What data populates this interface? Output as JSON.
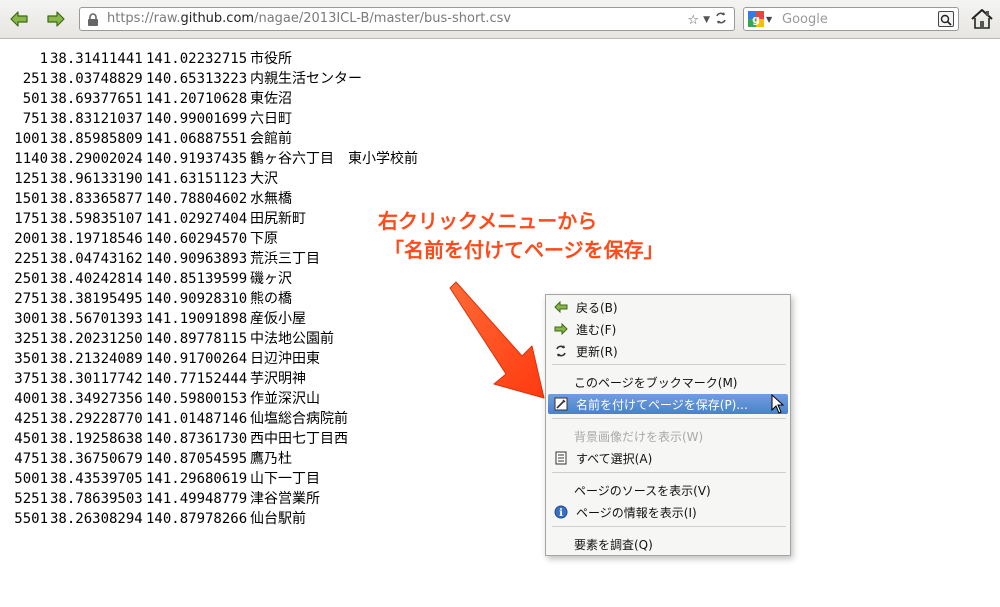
{
  "browser": {
    "url_prefix": "https://raw.",
    "url_host": "github.com",
    "url_path": "/nagae/2013ICL-B/master/bus-short.csv",
    "search_placeholder": "Google"
  },
  "rows": [
    {
      "id": "1",
      "lat": "38.31411441",
      "lon": "141.02232715",
      "name": "市役所"
    },
    {
      "id": "251",
      "lat": "38.03748829",
      "lon": "140.65313223",
      "name": "内親生活センター"
    },
    {
      "id": "501",
      "lat": "38.69377651",
      "lon": "141.20710628",
      "name": "東佐沼"
    },
    {
      "id": "751",
      "lat": "38.83121037",
      "lon": "140.99001699",
      "name": "六日町"
    },
    {
      "id": "1001",
      "lat": "38.85985809",
      "lon": "141.06887551",
      "name": "会館前"
    },
    {
      "id": "1140",
      "lat": "38.29002024",
      "lon": "140.91937435",
      "name": "鶴ヶ谷六丁目　東小学校前"
    },
    {
      "id": "1251",
      "lat": "38.96133190",
      "lon": "141.63151123",
      "name": "大沢"
    },
    {
      "id": "1501",
      "lat": "38.83365877",
      "lon": "140.78804602",
      "name": "水無橋"
    },
    {
      "id": "1751",
      "lat": "38.59835107",
      "lon": "141.02927404",
      "name": "田尻新町"
    },
    {
      "id": "2001",
      "lat": "38.19718546",
      "lon": "140.60294570",
      "name": "下原"
    },
    {
      "id": "2251",
      "lat": "38.04743162",
      "lon": "140.90963893",
      "name": "荒浜三丁目"
    },
    {
      "id": "2501",
      "lat": "38.40242814",
      "lon": "140.85139599",
      "name": "磯ヶ沢"
    },
    {
      "id": "2751",
      "lat": "38.38195495",
      "lon": "140.90928310",
      "name": "熊の橋"
    },
    {
      "id": "3001",
      "lat": "38.56701393",
      "lon": "141.19091898",
      "name": "産仮小屋"
    },
    {
      "id": "3251",
      "lat": "38.20231250",
      "lon": "140.89778115",
      "name": "中法地公園前"
    },
    {
      "id": "3501",
      "lat": "38.21324089",
      "lon": "140.91700264",
      "name": "日辺沖田東"
    },
    {
      "id": "3751",
      "lat": "38.30117742",
      "lon": "140.77152444",
      "name": "芋沢明神"
    },
    {
      "id": "4001",
      "lat": "38.34927356",
      "lon": "140.59800153",
      "name": "作並深沢山"
    },
    {
      "id": "4251",
      "lat": "38.29228770",
      "lon": "141.01487146",
      "name": "仙塩総合病院前"
    },
    {
      "id": "4501",
      "lat": "38.19258638",
      "lon": "140.87361730",
      "name": "西中田七丁目西"
    },
    {
      "id": "4751",
      "lat": "38.36750679",
      "lon": "140.87054595",
      "name": "鷹乃杜"
    },
    {
      "id": "5001",
      "lat": "38.43539705",
      "lon": "141.29680619",
      "name": "山下一丁目"
    },
    {
      "id": "5251",
      "lat": "38.78639503",
      "lon": "141.49948779",
      "name": "津谷営業所"
    },
    {
      "id": "5501",
      "lat": "38.26308294",
      "lon": "140.87978266",
      "name": "仙台駅前"
    }
  ],
  "annotation": {
    "line1": "右クリックメニューから",
    "line2": "「名前を付けてページを保存」",
    "color": "#ff4a1a"
  },
  "menu": {
    "back": "戻る(B)",
    "forward": "進む(F)",
    "reload": "更新(R)",
    "bookmark": "このページをブックマーク(M)",
    "save_as": "名前を付けてページを保存(P)...",
    "view_bg": "背景画像だけを表示(W)",
    "select_all": "すべて選択(A)",
    "view_source": "ページのソースを表示(V)",
    "page_info": "ページの情報を表示(I)",
    "inspect": "要素を調査(Q)"
  }
}
